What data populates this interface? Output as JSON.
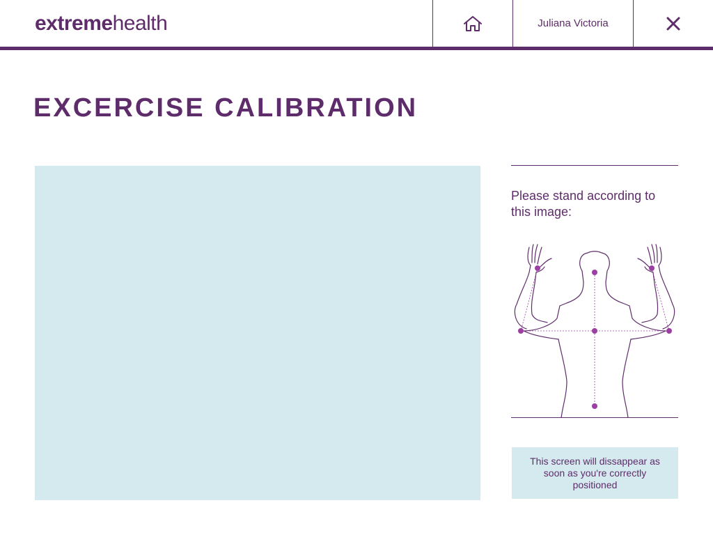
{
  "header": {
    "logo_bold": "extreme",
    "logo_light": "health",
    "user_name": "Juliana Victoria"
  },
  "icons": {
    "home": "home-icon",
    "close": "close-icon"
  },
  "page": {
    "title": "EXCERCISE CALIBRATION"
  },
  "calibration": {
    "instruction": "Please stand according to this image:",
    "notice": "This screen will dissappear as soon as you're correctly positioned"
  },
  "colors": {
    "primary": "#5e2c6a",
    "accent_dot": "#9b3fa3",
    "panel_bg": "#d4eaee"
  }
}
